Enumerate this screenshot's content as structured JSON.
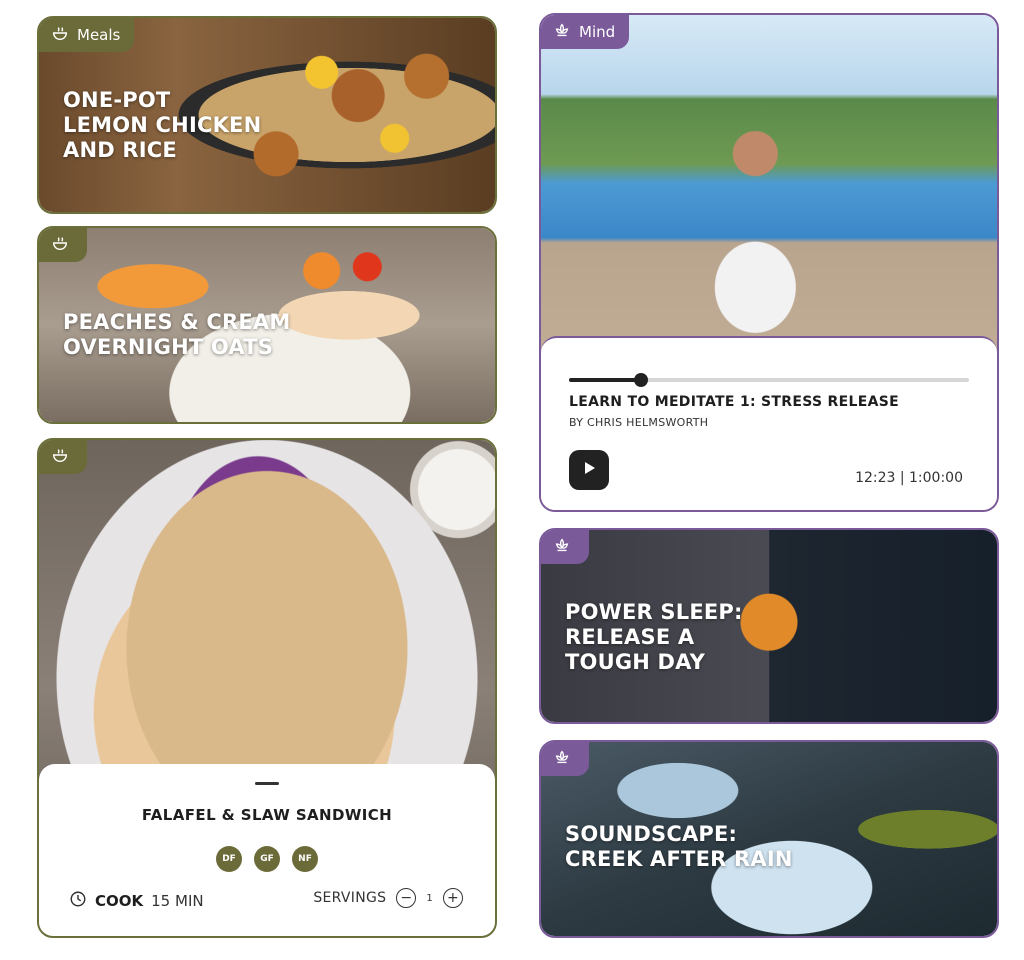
{
  "meals": {
    "badge_label": "Meals",
    "cards": [
      {
        "title_lines": [
          "One-Pot",
          "Lemon Chicken",
          "and Rice"
        ]
      },
      {
        "title_lines": [
          "Peaches & Cream",
          "Overnight Oats"
        ]
      },
      {
        "title": "Falafel & Slaw Sandwich",
        "tags": [
          "DF",
          "GF",
          "NF"
        ],
        "cook_label": "COOK",
        "cook_time": "15 MIN",
        "servings_label": "SERVINGS",
        "servings_value": "1",
        "minus": "−",
        "plus": "+"
      }
    ]
  },
  "mind": {
    "badge_label": "Mind",
    "player": {
      "title": "LEARN TO MEDITATE 1: STRESS RELEASE",
      "author": "BY CHRIS HELMSWORTH",
      "time": "12:23 | 1:00:00",
      "progress": 0.18
    },
    "cards": [
      {
        "title_lines": [
          "Power Sleep:",
          "Release a",
          "Tough Day"
        ]
      },
      {
        "title_lines": [
          "Soundscape:",
          "Creek After Rain"
        ]
      }
    ]
  },
  "colors": {
    "meals_accent": "#6b6a39",
    "mind_accent": "#7b5a9a"
  },
  "icons": {
    "meals": "bowl-icon",
    "mind": "lotus-icon",
    "cook": "clock-icon",
    "play": "play-icon"
  }
}
